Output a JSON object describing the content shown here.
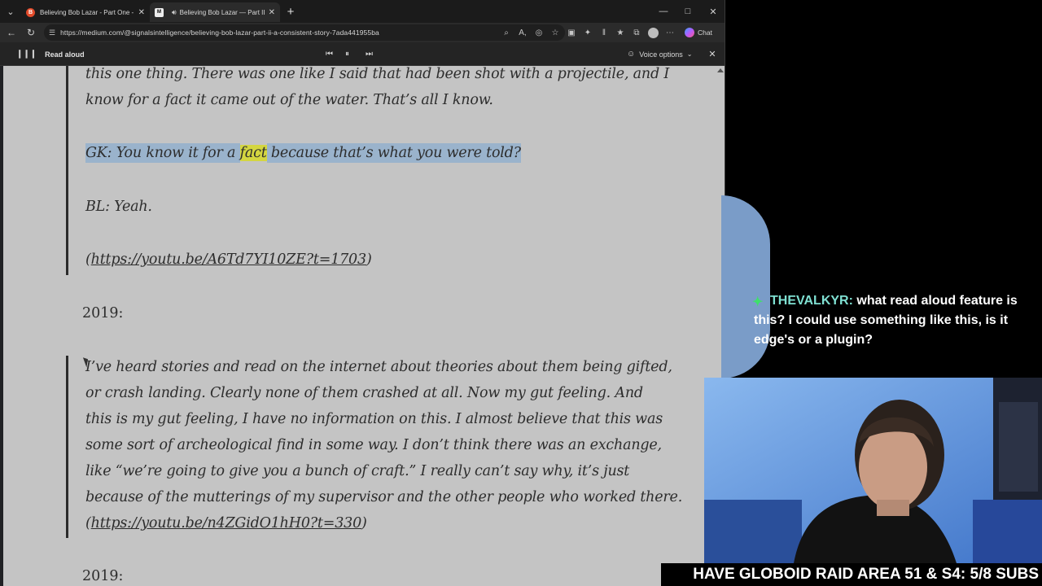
{
  "browser": {
    "tabs": [
      {
        "title": "Believing Bob Lazar - Part One - E",
        "favicon": "B",
        "active": false
      },
      {
        "title": "Believing Bob Lazar — Part II",
        "favicon": "M",
        "active": true
      }
    ],
    "new_tab": "+",
    "url": "https://medium.com/@signalsintelligence/believing-bob-lazar-part-ii-a-consistent-story-7ada441955ba",
    "chat_label": "Chat"
  },
  "read_aloud": {
    "label": "Read aloud",
    "voice_options": "Voice options"
  },
  "article": {
    "line1": "this one thing. There was one like I said that had been shot with a projectile, and I",
    "line2": "know for a fact it came out of the water. That’s all I know.",
    "gk_before": "GK: You know it for a ",
    "gk_word": "fact",
    "gk_after": " because that’s what you were told?",
    "bl": "BL: Yeah.",
    "link1_open": "(",
    "link1": "https://youtu.be/A6Td7YI10ZE?t=1703",
    "link1_close": ")",
    "year1": "2019:",
    "p1": "I’ve heard stories and read on the internet about theories about them being gifted,",
    "p2": "or crash landing. Clearly none of them crashed at all. Now my gut feeling. And",
    "p3": "this is my gut feeling, I have no information on this. I almost believe that this was",
    "p4": "some sort of archeological find in some way. I don’t think there was an exchange,",
    "p5": "like “we’re going to give you a bunch of craft.” I really can’t say why, it’s just",
    "p6": "because of the mutterings of my supervisor and the other people who worked there.",
    "link2_open": "(",
    "link2": "https://youtu.be/n4ZGidO1hH0?t=330",
    "link2_close": ")",
    "year2": "2019:"
  },
  "stream": {
    "chat_user": "THEVALKYR:",
    "chat_message": " what read aloud feature is this? I could use something like this, is it edge's or a plugin?",
    "ticker": "HAVE GLOBOID RAID AREA 51 & S4: 5/8 SUBS"
  },
  "colors": {
    "page_bg": "#c4c4c4",
    "highlight_line": "#9ab3cc",
    "highlight_word": "#d4d640",
    "chat_user": "#7fe0d2"
  }
}
